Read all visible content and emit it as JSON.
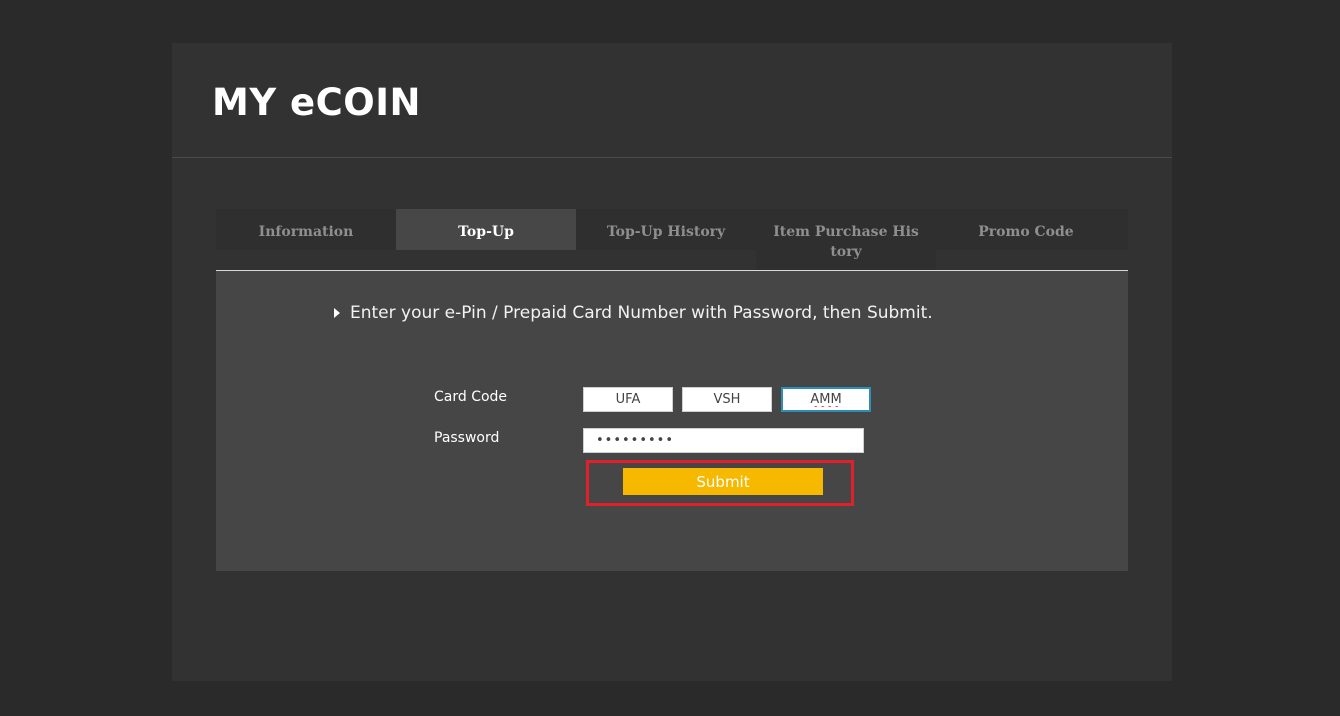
{
  "header": {
    "title": "MY eCOIN"
  },
  "tabs": [
    {
      "label": "Information",
      "active": false
    },
    {
      "label": "Top-Up",
      "active": true
    },
    {
      "label": "Top-Up History",
      "active": false
    },
    {
      "label": "Item Purchase History",
      "active": false
    },
    {
      "label": "Promo Code",
      "active": false
    }
  ],
  "form": {
    "instruction": "Enter your e-Pin / Prepaid Card Number with Password, then Submit.",
    "card_code_label": "Card Code",
    "card_code_values": [
      "UFA",
      "VSH",
      "AMM"
    ],
    "password_label": "Password",
    "password_value": "•••••••••",
    "submit_label": "Submit"
  },
  "colors": {
    "page_bg": "#2a2a2a",
    "panel_bg": "#333232",
    "content_bg": "#464646",
    "accent": "#f7b800",
    "highlight": "#e0202a",
    "focus_border": "#2e8fb5"
  }
}
